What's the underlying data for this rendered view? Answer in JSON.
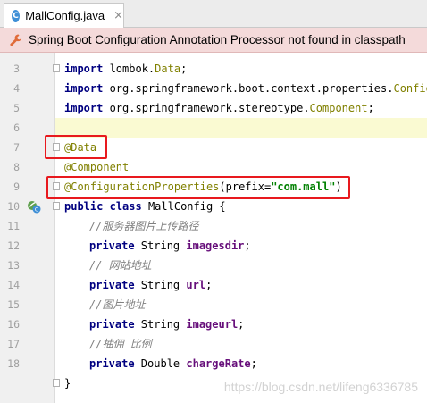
{
  "tab": {
    "icon": "class-icon",
    "icon_letter": "C",
    "label": "MallConfig.java",
    "close": "×"
  },
  "banner": {
    "icon": "wrench-icon",
    "text": "Spring Boot Configuration Annotation Processor not found in classpath"
  },
  "lines": [
    {
      "num": "3"
    },
    {
      "num": "4"
    },
    {
      "num": "5"
    },
    {
      "num": "6"
    },
    {
      "num": "7"
    },
    {
      "num": "8"
    },
    {
      "num": "9"
    },
    {
      "num": "10"
    },
    {
      "num": "11"
    },
    {
      "num": "12"
    },
    {
      "num": "13"
    },
    {
      "num": "14"
    },
    {
      "num": "15"
    },
    {
      "num": "16"
    },
    {
      "num": "17"
    },
    {
      "num": "18"
    }
  ],
  "code": {
    "l3": {
      "kw": "import",
      "pkg": " lombok.",
      "cls": "Data",
      "end": ";"
    },
    "l4": {
      "kw": "import",
      "pkg": " org.springframework.boot.context.properties.",
      "cls": "Configu"
    },
    "l5": {
      "kw": "import",
      "pkg": " org.springframework.stereotype.",
      "cls": "Component",
      "end": ";"
    },
    "l7": {
      "ann": "@Data"
    },
    "l8": {
      "ann": "@Component"
    },
    "l9": {
      "ann": "@ConfigurationProperties",
      "open": "(prefix=",
      "str": "\"com.mall\"",
      "close": ")"
    },
    "l10": {
      "kw1": "public",
      "kw2": "class",
      "name": " MallConfig {"
    },
    "l11": {
      "cmt": "//服务器图片上传路径"
    },
    "l12": {
      "kw": "private",
      "type": " String ",
      "fld": "imagesdir",
      "end": ";"
    },
    "l13": {
      "cmt": "// 网站地址"
    },
    "l14": {
      "kw": "private",
      "type": " String ",
      "fld": "url",
      "end": ";"
    },
    "l15": {
      "cmt": "//图片地址"
    },
    "l16": {
      "kw": "private",
      "type": " String ",
      "fld": "imageurl",
      "end": ";"
    },
    "l17": {
      "cmt": "//抽佣 比例"
    },
    "l18": {
      "kw": "private",
      "type": " Double ",
      "fld": "chargeRate",
      "end": ";"
    },
    "l19": {
      "text": "}"
    }
  },
  "watermark": "https://blog.csdn.net/lifeng6336785"
}
